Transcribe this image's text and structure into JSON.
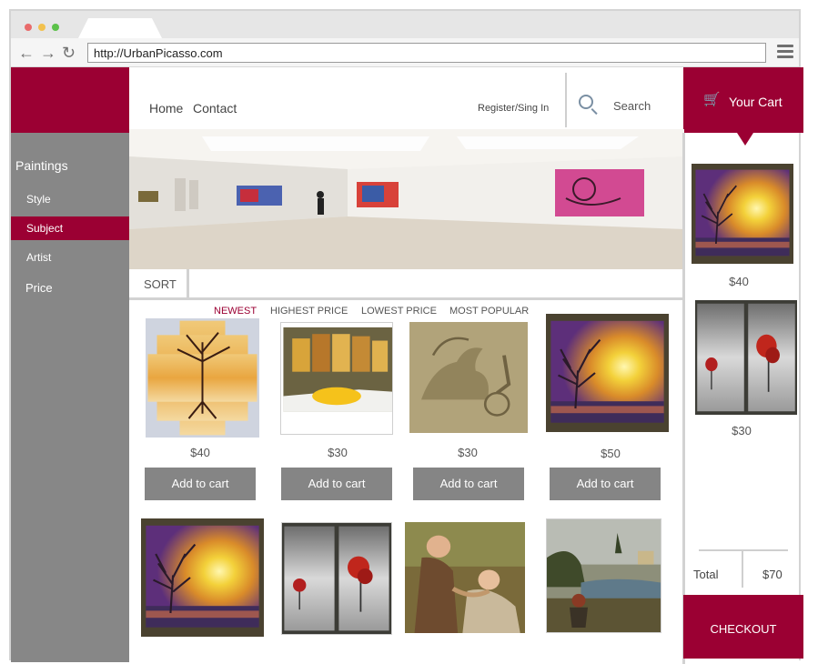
{
  "browser": {
    "url": "http://UrbanPicasso.com",
    "traffic_lights": [
      "#e96b6b",
      "#f2c14e",
      "#5cc24a"
    ]
  },
  "header": {
    "nav": [
      "Home",
      "Contact"
    ],
    "register": "Register/Sing In",
    "search_label": "Search"
  },
  "cart": {
    "title": "Your Cart",
    "items": [
      {
        "price": "$40",
        "art": "sunset-tree"
      },
      {
        "price": "$30",
        "art": "red-trees-diptych"
      }
    ],
    "total_label": "Total",
    "total_value": "$70",
    "checkout": "CHECKOUT"
  },
  "sidebar": {
    "heading": "Paintings",
    "items": [
      "Style",
      "Subject",
      "Artist"
    ],
    "active_item": "Subject",
    "price": "Price"
  },
  "sort": {
    "label": "SORT",
    "options": [
      "NEWEST",
      "HIGHEST PRICE",
      "LOWEST PRICE",
      "MOST POPULAR"
    ],
    "active": "NEWEST"
  },
  "products": [
    {
      "art": "golden-tree-panels",
      "price": "$40",
      "button": "Add to cart"
    },
    {
      "art": "room-abstract-panels",
      "price": "$30",
      "button": "Add to cart"
    },
    {
      "art": "pegasus-relief",
      "price": "$30",
      "button": "Add to cart"
    },
    {
      "art": "sunset-tree",
      "price": "$50",
      "button": "Add to cart"
    },
    {
      "art": "sunset-tree",
      "price": null,
      "button": null
    },
    {
      "art": "red-trees-diptych",
      "price": null,
      "button": null
    },
    {
      "art": "romantic-couple",
      "price": null,
      "button": null
    },
    {
      "art": "river-landscape",
      "price": null,
      "button": null
    }
  ],
  "colors": {
    "brand": "#9b0033",
    "sidebar": "#878787",
    "button": "#858585"
  }
}
